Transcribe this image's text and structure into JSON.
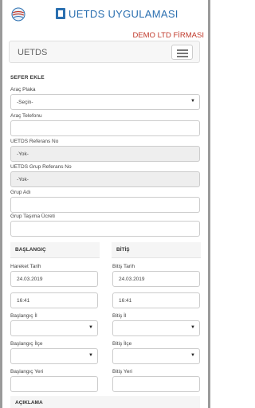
{
  "app": {
    "title": "UETDS UYGULAMASI",
    "company": "DEMO LTD FİRMASI",
    "nav_brand": "UETDS"
  },
  "form": {
    "section": "SEFER EKLE",
    "plaka": {
      "label": "Araç Plaka",
      "value": "-Seçin-"
    },
    "telefon": {
      "label": "Araç Telefonu",
      "value": ""
    },
    "referans": {
      "label": "UETDS Referans No",
      "value": "-Yok-"
    },
    "grup_referans": {
      "label": "UETDS Grup Referans No",
      "value": "-Yok-"
    },
    "grup_adi": {
      "label": "Grup Adı",
      "value": ""
    },
    "grup_ucret": {
      "label": "Grup Taşıma Ücreti",
      "value": ""
    }
  },
  "baslangic": {
    "title": "BAŞLANGIÇ",
    "tarih_label": "Hareket Tarih",
    "tarih": "24.03.2019",
    "saat": "16:41",
    "il_label": "Başlangıç İl",
    "ilce_label": "Başlangıç İlçe",
    "yer_label": "Başlangıç Yeri"
  },
  "bitis": {
    "title": "BİTİŞ",
    "tarih_label": "Bitiş Tarih",
    "tarih": "24.03.2019",
    "saat": "16:41",
    "il_label": "Bitiş İl",
    "ilce_label": "Bitiş İlçe",
    "yer_label": "Bitiş Yeri"
  },
  "aciklama": {
    "title": "AÇIKLAMA"
  },
  "icons": {
    "globe": "globe-icon",
    "logo": "truck-logo-icon",
    "menu": "hamburger-menu-icon",
    "caret": "caret-down-icon"
  }
}
